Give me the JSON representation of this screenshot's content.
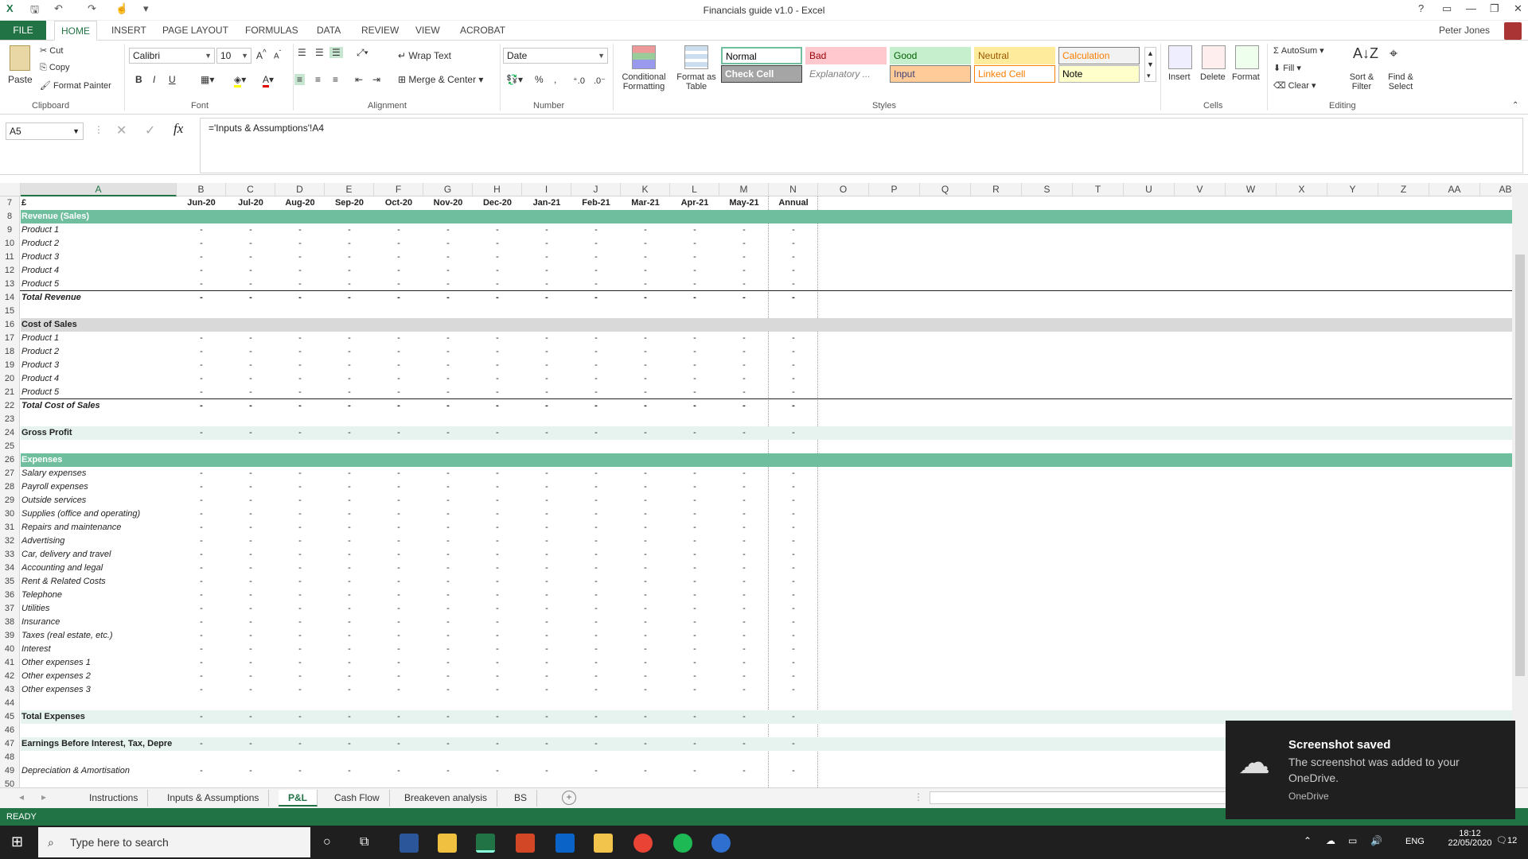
{
  "window": {
    "title": "Financials guide v1.0 - Excel",
    "user": "Peter Jones"
  },
  "tabs": [
    "FILE",
    "HOME",
    "INSERT",
    "PAGE LAYOUT",
    "FORMULAS",
    "DATA",
    "REVIEW",
    "VIEW",
    "ACROBAT"
  ],
  "ribbon": {
    "clipboard": {
      "paste": "Paste",
      "cut": "Cut",
      "copy": "Copy",
      "format_painter": "Format Painter",
      "label": "Clipboard"
    },
    "font": {
      "name": "Calibri",
      "size": "10",
      "label": "Font",
      "bold": "B",
      "italic": "I",
      "underline": "U"
    },
    "alignment": {
      "wrap": "Wrap Text",
      "merge": "Merge & Center",
      "label": "Alignment"
    },
    "number": {
      "format": "Date",
      "percent": "%",
      "comma": ",",
      "label": "Number"
    },
    "styles": {
      "conditional": "Conditional Formatting",
      "format_table": "Format as Table",
      "cells": [
        {
          "name": "Normal",
          "bg": "#ffffff",
          "fg": "#000000",
          "border": "#6fbf9f"
        },
        {
          "name": "Bad",
          "bg": "#ffc7ce",
          "fg": "#9c0006",
          "border": "#ffc7ce"
        },
        {
          "name": "Good",
          "bg": "#c6efce",
          "fg": "#006100",
          "border": "#c6efce"
        },
        {
          "name": "Neutral",
          "bg": "#ffeb9c",
          "fg": "#9c5700",
          "border": "#ffeb9c"
        },
        {
          "name": "Calculation",
          "bg": "#f2f2f2",
          "fg": "#fa7d00",
          "border": "#7f7f7f"
        },
        {
          "name": "Check Cell",
          "bg": "#a5a5a5",
          "fg": "#ffffff",
          "border": "#3f3f3f"
        },
        {
          "name": "Explanatory ...",
          "bg": "#ffffff",
          "fg": "#7f7f7f",
          "border": "#ffffff"
        },
        {
          "name": "Input",
          "bg": "#ffcc99",
          "fg": "#3f3f76",
          "border": "#7f7f7f"
        },
        {
          "name": "Linked Cell",
          "bg": "#ffffff",
          "fg": "#fa7d00",
          "border": "#ff8001"
        },
        {
          "name": "Note",
          "bg": "#ffffcc",
          "fg": "#000000",
          "border": "#b2b2b2"
        }
      ],
      "label": "Styles"
    },
    "cells": {
      "insert": "Insert",
      "delete": "Delete",
      "format": "Format",
      "label": "Cells"
    },
    "editing": {
      "autosum": "AutoSum",
      "fill": "Fill",
      "clear": "Clear",
      "sort": "Sort & Filter",
      "find": "Find & Select",
      "label": "Editing"
    }
  },
  "formula_bar": {
    "name_box": "A5",
    "formula": "='Inputs & Assumptions'!A4"
  },
  "columns": [
    "A",
    "B",
    "C",
    "D",
    "E",
    "F",
    "G",
    "H",
    "I",
    "J",
    "K",
    "L",
    "M",
    "N",
    "O",
    "P",
    "Q",
    "R",
    "S",
    "T",
    "U",
    "V",
    "W",
    "X",
    "Y",
    "Z",
    "AA",
    "AB"
  ],
  "months": [
    "Jun-20",
    "Jul-20",
    "Aug-20",
    "Sep-20",
    "Oct-20",
    "Nov-20",
    "Dec-20",
    "Jan-21",
    "Feb-21",
    "Mar-21",
    "Apr-21",
    "May-21",
    "Annual"
  ],
  "currency": "£",
  "dash": "-",
  "rows": [
    {
      "n": "8",
      "label": "Revenue (Sales)",
      "style": "teal",
      "vals": false
    },
    {
      "n": "9",
      "label": "Product 1",
      "style": "i",
      "vals": true
    },
    {
      "n": "10",
      "label": "Product 2",
      "style": "i",
      "vals": true
    },
    {
      "n": "11",
      "label": "Product 3",
      "style": "i",
      "vals": true
    },
    {
      "n": "12",
      "label": "Product 4",
      "style": "i",
      "vals": true
    },
    {
      "n": "13",
      "label": "Product 5",
      "style": "i",
      "vals": true,
      "line": true
    },
    {
      "n": "14",
      "label": "Total Revenue",
      "style": "bi",
      "vals": true
    },
    {
      "n": "15",
      "label": "",
      "style": "i",
      "vals": false
    },
    {
      "n": "16",
      "label": "Cost of Sales",
      "style": "grey",
      "vals": false
    },
    {
      "n": "17",
      "label": "Product 1",
      "style": "i",
      "vals": true
    },
    {
      "n": "18",
      "label": "Product 2",
      "style": "i",
      "vals": true
    },
    {
      "n": "19",
      "label": "Product 3",
      "style": "i",
      "vals": true
    },
    {
      "n": "20",
      "label": "Product 4",
      "style": "i",
      "vals": true
    },
    {
      "n": "21",
      "label": "Product 5",
      "style": "i",
      "vals": true,
      "line": true
    },
    {
      "n": "22",
      "label": "Total Cost of Sales",
      "style": "bi",
      "vals": true
    },
    {
      "n": "23",
      "label": "",
      "style": "i",
      "vals": false
    },
    {
      "n": "24",
      "label": "Gross Profit",
      "style": "lt",
      "vals": true
    },
    {
      "n": "25",
      "label": "",
      "style": "i",
      "vals": false
    },
    {
      "n": "26",
      "label": "Expenses",
      "style": "teal",
      "vals": false
    },
    {
      "n": "27",
      "label": "Salary expenses",
      "style": "i",
      "vals": true
    },
    {
      "n": "28",
      "label": "Payroll expenses",
      "style": "i",
      "vals": true
    },
    {
      "n": "29",
      "label": "Outside services",
      "style": "i",
      "vals": true
    },
    {
      "n": "30",
      "label": "Supplies (office and operating)",
      "style": "i",
      "vals": true
    },
    {
      "n": "31",
      "label": "Repairs and maintenance",
      "style": "i",
      "vals": true
    },
    {
      "n": "32",
      "label": "Advertising",
      "style": "i",
      "vals": true
    },
    {
      "n": "33",
      "label": "Car, delivery and travel",
      "style": "i",
      "vals": true
    },
    {
      "n": "34",
      "label": "Accounting and legal",
      "style": "i",
      "vals": true
    },
    {
      "n": "35",
      "label": "Rent & Related Costs",
      "style": "i",
      "vals": true
    },
    {
      "n": "36",
      "label": "Telephone",
      "style": "i",
      "vals": true
    },
    {
      "n": "37",
      "label": "Utilities",
      "style": "i",
      "vals": true
    },
    {
      "n": "38",
      "label": "Insurance",
      "style": "i",
      "vals": true
    },
    {
      "n": "39",
      "label": "Taxes (real estate, etc.)",
      "style": "i",
      "vals": true
    },
    {
      "n": "40",
      "label": "Interest",
      "style": "i",
      "vals": true
    },
    {
      "n": "41",
      "label": "Other expenses 1",
      "style": "i",
      "vals": true
    },
    {
      "n": "42",
      "label": "Other expenses 2",
      "style": "i",
      "vals": true
    },
    {
      "n": "43",
      "label": "Other expenses 3",
      "style": "i",
      "vals": true
    },
    {
      "n": "44",
      "label": "",
      "style": "i",
      "vals": false
    },
    {
      "n": "45",
      "label": "Total Expenses",
      "style": "lt",
      "vals": true
    },
    {
      "n": "46",
      "label": "",
      "style": "i",
      "vals": false
    },
    {
      "n": "47",
      "label": "Earnings Before Interest, Tax, Depre",
      "style": "lt",
      "vals": true
    },
    {
      "n": "48",
      "label": "",
      "style": "i",
      "vals": false
    },
    {
      "n": "49",
      "label": "Depreciation & Amortisation",
      "style": "i",
      "vals": true
    },
    {
      "n": "50",
      "label": "",
      "style": "i",
      "vals": false
    }
  ],
  "sheet_tabs": [
    "Instructions",
    "Inputs & Assumptions",
    "P&L",
    "Cash Flow",
    "Breakeven analysis",
    "BS"
  ],
  "active_sheet": "P&L",
  "status": "READY",
  "toast": {
    "title": "Screenshot saved",
    "body": "The screenshot was added to your OneDrive.",
    "source": "OneDrive"
  },
  "taskbar": {
    "search": "Type here to search",
    "lang": "ENG",
    "time": "18:12",
    "date": "22/05/2020",
    "notif": "12"
  }
}
